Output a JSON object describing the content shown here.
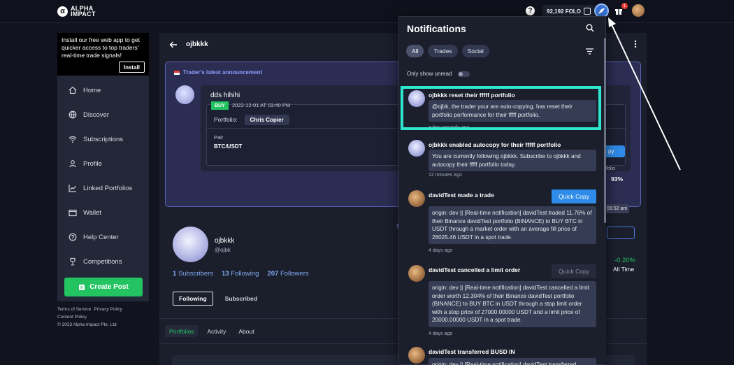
{
  "topbar": {
    "logo_mark": "α",
    "logo_line1": "ALPHA",
    "logo_line2": "IMPACT",
    "help": "?",
    "folo_balance": "92,192 FOLO",
    "gift_badge": "1"
  },
  "install": {
    "text": "Install our free web app to get quicker access to top traders' real-time trade signals!",
    "button": "Install"
  },
  "sidebar": {
    "items": [
      {
        "label": "Home",
        "icon": "home-icon"
      },
      {
        "label": "Discover",
        "icon": "globe-icon"
      },
      {
        "label": "Subscriptions",
        "icon": "wifi-icon"
      },
      {
        "label": "Profile",
        "icon": "user-icon"
      },
      {
        "label": "Linked Portfolios",
        "icon": "chart-icon"
      },
      {
        "label": "Wallet",
        "icon": "wallet-icon"
      },
      {
        "label": "Help Center",
        "icon": "help-circle-icon"
      },
      {
        "label": "Competitions",
        "icon": "trophy-icon"
      }
    ],
    "create_post": "Create Post"
  },
  "footer": {
    "terms": "Terms of Service",
    "privacy": "Privacy Policy",
    "content": "Content Policy",
    "copyright": "© 2023 Alpha Impact Pte. Ltd"
  },
  "main": {
    "title": "ojbkkk",
    "announcement_heading": "Trader's latest announcement",
    "post_text": "dds hihihi",
    "buy_label": "BUY",
    "trade_time": "2022-12-01 AT 03:40 PM",
    "portfolio_label": "Portfolio:",
    "portfolio_name": "Chris Copier",
    "pair_label": "Pair",
    "pair_value": "BTC/USDT",
    "copy_edge": "py",
    "folio_edge": "folio",
    "pct_edge": "93%",
    "time_edge": "06:52 am",
    "see_edge": "Se",
    "profile_name": "ojbkkk",
    "profile_handle": "@ojbk",
    "subscribers": {
      "count": "1",
      "label": "Subscribers"
    },
    "following": {
      "count": "13",
      "label": "Following"
    },
    "followers": {
      "count": "207",
      "label": "Followers"
    },
    "follow_tab_active": "Following",
    "follow_tab": "Subscribed",
    "perf_value": "-0.20%",
    "perf_label": "All Time",
    "content_tabs": [
      "Portfolios",
      "Activity",
      "About"
    ]
  },
  "notifications": {
    "title": "Notifications",
    "filters": [
      "All",
      "Trades",
      "Social"
    ],
    "unread_label": "Only show unread",
    "items": [
      {
        "title": "ojbkkk reset their fffff portfolio",
        "body": "@ojbk, the trader your are auto-copying, has reset their portfolio performance for their fffff portfolio.",
        "time": "a few seconds ago"
      },
      {
        "title": "ojbkkk enabled autocopy for their fffff portfolio",
        "body": "You are currently following ojbkkk. Subscribe to ojbkkk and autocopy their fffff portfolio today.",
        "time": "12 minutes ago"
      },
      {
        "title": "davidTest made a trade",
        "button": "Quick Copy",
        "body": "origin: dev || [Real-time notification] davidTest traded 11.76% of their Binance davidTest portfolio (BINANCE) to BUY BTC in USDT through a market order with an average fill price of 28025.46 USDT in a spot trade.",
        "time": "4 days ago"
      },
      {
        "title": "davidTest cancelled a limit order",
        "button": "Quick Copy",
        "body": "origin: dev || [Real-time notification] davidTest cancelled a limit order worth 12.304% of their Binance davidTest portfolio (BINANCE) to BUY BTC in USDT through a stop limit order with a stop price of 27000.00000 USDT and a limit price of 20000.00000 USDT in a spot trade.",
        "time": "4 days ago"
      },
      {
        "title": "davidTest transferred BUSD IN",
        "body": "origin: dev || [Real-time notification] davidTest transferred BUSD"
      }
    ]
  },
  "colors": {
    "accent_green": "#23c362",
    "accent_blue": "#2e8be8",
    "highlight": "#2ee6cf"
  }
}
